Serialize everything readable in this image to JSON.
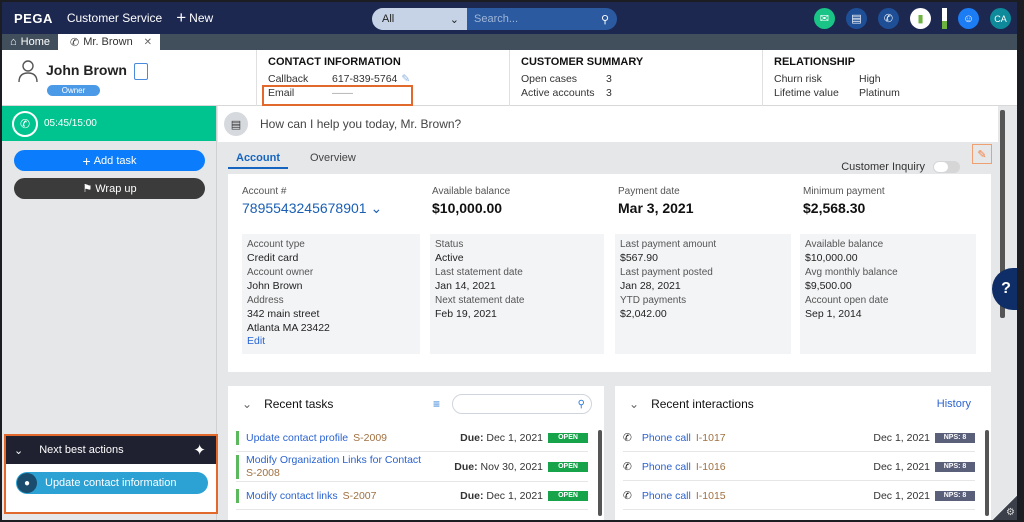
{
  "topbar": {
    "logo": "PEGA",
    "app_name": "Customer Service",
    "new_label": "New",
    "search_scope": "All",
    "search_placeholder": "Search...",
    "avatar_initials": "CA",
    "battery_level": 0.4
  },
  "tabs": [
    {
      "label": "Home",
      "icon": "home-icon"
    },
    {
      "label": "Mr. Brown",
      "icon": "phone-icon"
    }
  ],
  "customer": {
    "name": "John Brown",
    "role_badge": "Owner"
  },
  "contact_info": {
    "title": "CONTACT INFORMATION",
    "callback_label": "Callback",
    "callback_value": "617-839-5764",
    "email_label": "Email",
    "email_value": "——"
  },
  "customer_summary": {
    "title": "CUSTOMER SUMMARY",
    "open_cases_label": "Open cases",
    "open_cases_value": "3",
    "active_accounts_label": "Active accounts",
    "active_accounts_value": "3"
  },
  "relationship": {
    "title": "RELATIONSHIP",
    "churn_label": "Churn risk",
    "churn_value": "High",
    "lifetime_label": "Lifetime value",
    "lifetime_value": "Platinum"
  },
  "call": {
    "timer": "05:45/15:00"
  },
  "left_actions": {
    "add_task": "Add task",
    "wrap_up": "Wrap up"
  },
  "nba": {
    "title": "Next best actions",
    "action": "Update contact information"
  },
  "main": {
    "prompt": "How can I help you today, Mr. Brown?",
    "tabs": [
      "Account",
      "Overview"
    ],
    "customer_inquiry_label": "Customer Inquiry"
  },
  "account": {
    "acct_label": "Account #",
    "acct_value": "7895543245678901",
    "avail_label": "Available balance",
    "avail_value": "$10,000.00",
    "paydate_label": "Payment date",
    "paydate_value": "Mar 3, 2021",
    "minpay_label": "Minimum payment",
    "minpay_value": "$2,568.30",
    "col1": [
      {
        "label": "Account type",
        "value": "Credit card"
      },
      {
        "label": "Account owner",
        "value": "John Brown"
      },
      {
        "label": "Address",
        "value": "342 main street",
        "value2": "Atlanta  MA 23422"
      }
    ],
    "edit_label": "Edit",
    "col2": [
      {
        "label": "Status",
        "value": "Active"
      },
      {
        "label": "Last statement date",
        "value": "Jan 14, 2021"
      },
      {
        "label": "Next statement date",
        "value": "Feb 19, 2021"
      }
    ],
    "col3": [
      {
        "label": "Last payment amount",
        "value": "$567.90"
      },
      {
        "label": "Last payment posted",
        "value": "Jan 28, 2021"
      },
      {
        "label": "YTD payments",
        "value": "$2,042.00"
      }
    ],
    "col4": [
      {
        "label": "Available balance",
        "value": "$10,000.00"
      },
      {
        "label": "Avg monthly balance",
        "value": "$9,500.00"
      },
      {
        "label": "Account open date",
        "value": "Sep 1, 2014"
      }
    ]
  },
  "recent_tasks": {
    "title": "Recent tasks",
    "due_label": "Due:",
    "items": [
      {
        "title": "Update contact profile",
        "id": "S-2009",
        "due": "Dec 1, 2021",
        "status": "OPEN"
      },
      {
        "title": "Modify Organization Links for Contact",
        "id": "S-2008",
        "due": "Nov 30, 2021",
        "status": "OPEN"
      },
      {
        "title": "Modify contact links",
        "id": "S-2007",
        "due": "Dec 1, 2021",
        "status": "OPEN"
      }
    ]
  },
  "recent_interactions": {
    "title": "Recent interactions",
    "history_label": "History",
    "items": [
      {
        "type": "Phone call",
        "id": "I-1017",
        "date": "Dec 1, 2021",
        "nps": "NPS: 8"
      },
      {
        "type": "Phone call",
        "id": "I-1016",
        "date": "Dec 1, 2021",
        "nps": "NPS: 8"
      },
      {
        "type": "Phone call",
        "id": "I-1015",
        "date": "Dec 1, 2021",
        "nps": "NPS: 8"
      }
    ]
  },
  "colors": {
    "topbar": "#1d2851",
    "accent": "#1565c0",
    "timer": "#00c48f",
    "highlight": "#e0692b",
    "open_badge": "#16a34a"
  }
}
